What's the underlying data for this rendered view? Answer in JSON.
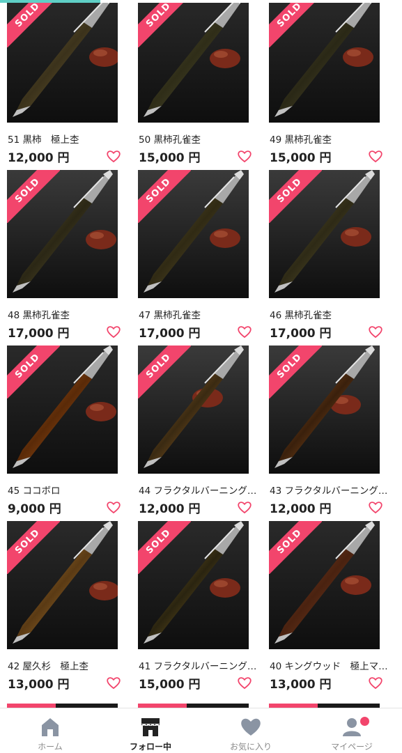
{
  "progress": 0.25,
  "colors": {
    "accent": "#5fcfc6",
    "sold": "#f2456c",
    "heart": "#f2456c",
    "icon_gray": "#8a94a3"
  },
  "sold_label": "SOLD",
  "products": [
    {
      "title": "51 黒柿　極上杢",
      "price": "12,000 円",
      "sold": true
    },
    {
      "title": "50 黒柿孔雀杢",
      "price": "15,000 円",
      "sold": true
    },
    {
      "title": "49 黒柿孔雀杢",
      "price": "15,000 円",
      "sold": true
    },
    {
      "title": "48 黒柿孔雀杢",
      "price": "17,000 円",
      "sold": true
    },
    {
      "title": "47 黒柿孔雀杢",
      "price": "17,000 円",
      "sold": true
    },
    {
      "title": "46 黒柿孔雀杢",
      "price": "17,000 円",
      "sold": true
    },
    {
      "title": "45 ココボロ",
      "price": "9,000 円",
      "sold": true
    },
    {
      "title": "44 フラクタルバーニング…",
      "price": "12,000 円",
      "sold": true
    },
    {
      "title": "43 フラクタルバーニング…",
      "price": "12,000 円",
      "sold": true
    },
    {
      "title": "42 屋久杉　極上杢",
      "price": "13,000 円",
      "sold": true
    },
    {
      "title": "41 フラクタルバーニング…",
      "price": "15,000 円",
      "sold": true
    },
    {
      "title": "40 キングウッド　極上マ…",
      "price": "13,000 円",
      "sold": true
    }
  ],
  "tabbar": {
    "home": {
      "label": "ホーム",
      "icon": "home-icon"
    },
    "following": {
      "label": "フォロー中",
      "icon": "shop-icon"
    },
    "favorites": {
      "label": "お気に入り",
      "icon": "heart-icon"
    },
    "mypage": {
      "label": "マイページ",
      "icon": "user-icon"
    }
  }
}
